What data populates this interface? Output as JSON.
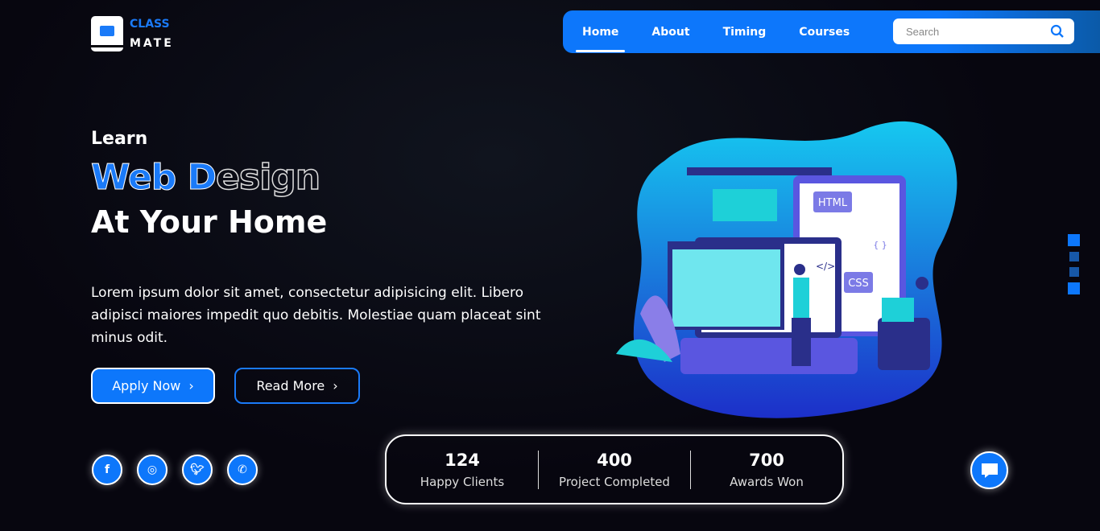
{
  "logo": {
    "line1": "CLASS",
    "line2": "MATE"
  },
  "nav": {
    "items": [
      {
        "label": "Home",
        "active": true
      },
      {
        "label": "About"
      },
      {
        "label": "Timing"
      },
      {
        "label": "Courses"
      }
    ],
    "search_placeholder": "Search"
  },
  "hero": {
    "learn": "Learn",
    "highlight_solid": "Web D",
    "highlight_outline": "esign",
    "subtitle": "At Your Home",
    "description": "Lorem ipsum dolor sit amet, consectetur adipisicing elit. Libero adipisci maiores impedit quo debitis. Molestiae quam placeat sint minus odit.",
    "apply": "Apply Now",
    "read": "Read More"
  },
  "illustration": {
    "html": "HTML",
    "css": "CSS",
    "braces": "{ }",
    "code": "</>"
  },
  "social": [
    "facebook-icon",
    "instagram-icon",
    "twitter-icon",
    "whatsapp-icon"
  ],
  "stats": [
    {
      "value": "124",
      "label": "Happy Clients"
    },
    {
      "value": "400",
      "label": "Project Completed"
    },
    {
      "value": "700",
      "label": "Awards Won"
    }
  ],
  "colors": {
    "accent": "#0d77fb",
    "background": "#07060f"
  }
}
